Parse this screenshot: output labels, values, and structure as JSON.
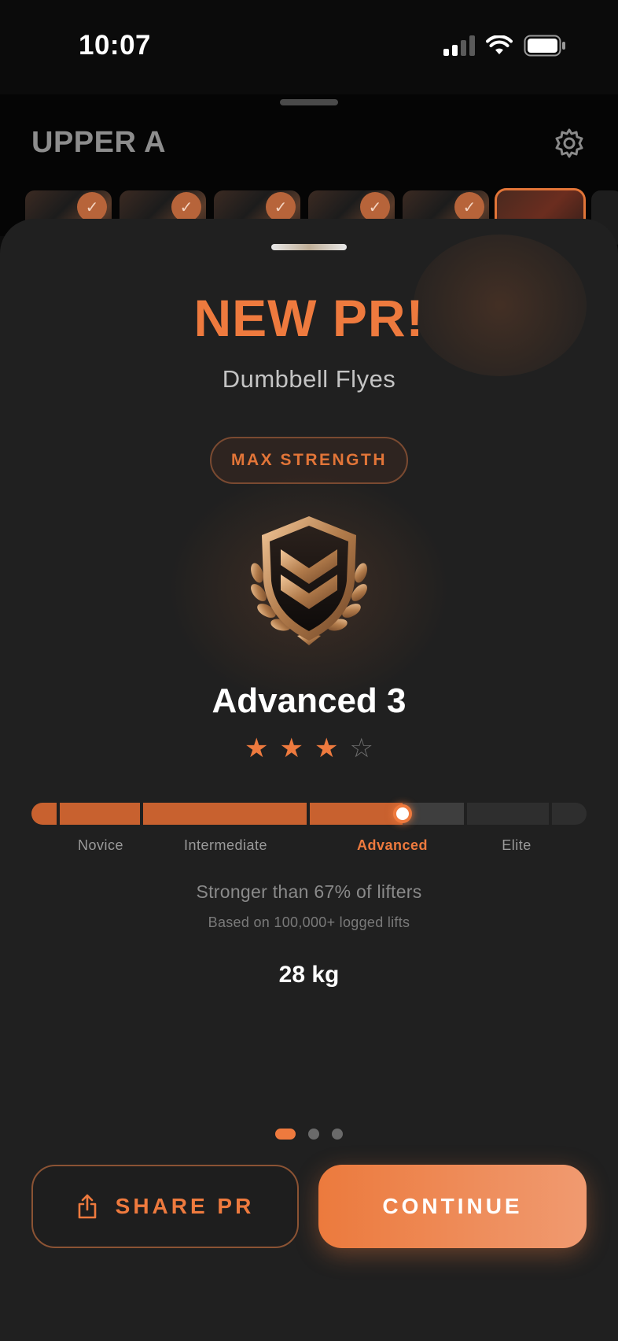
{
  "status_bar": {
    "time": "10:07",
    "signal_icon": "cellular-signal-icon",
    "wifi_icon": "wifi-icon",
    "battery_icon": "battery-icon"
  },
  "workout": {
    "title": "UPPER A",
    "settings_icon": "gear-icon",
    "thumbnails": [
      {
        "completed": true
      },
      {
        "completed": true
      },
      {
        "completed": true
      },
      {
        "completed": true
      },
      {
        "completed": true
      },
      {
        "completed": false,
        "current": true
      }
    ]
  },
  "pr_sheet": {
    "headline": "NEW PR!",
    "exercise": "Dumbbell Flyes",
    "category_badge": "MAX STRENGTH",
    "emblem_icon": "chevron-shield-icon",
    "level": "Advanced 3",
    "stars": {
      "filled": 3,
      "total": 4
    },
    "progress": {
      "levels": [
        "Novice",
        "Intermediate",
        "Advanced",
        "Elite"
      ],
      "current_level": "Advanced",
      "percentile": 67
    },
    "stronger_text": "Stronger than 67% of lifters",
    "based_text": "Based on 100,000+ logged lifts",
    "weight": "28 kg",
    "pager": {
      "pages": 3,
      "active": 0
    },
    "share_button": "SHARE PR",
    "share_icon": "share-icon",
    "continue_button": "CONTINUE"
  },
  "colors": {
    "accent": "#ee7a3e",
    "sheet_background": "#202020",
    "muted_text": "#8a8a8a"
  }
}
